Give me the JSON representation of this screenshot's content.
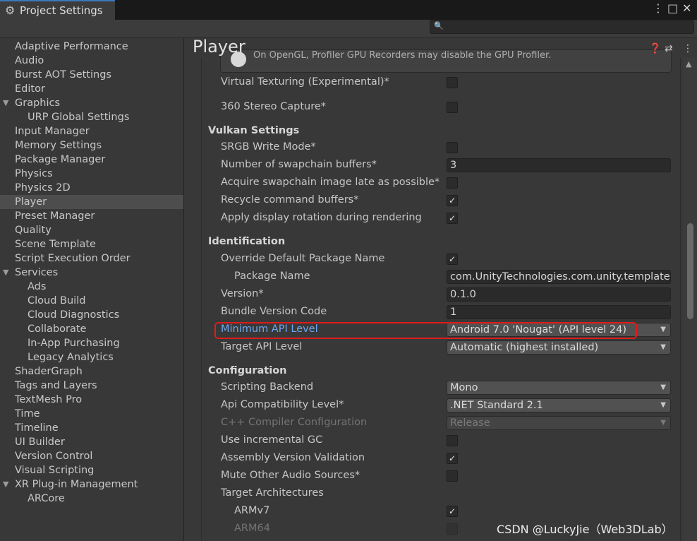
{
  "window": {
    "title": "Project Settings",
    "icons": {
      "tab": "gear-icon",
      "menu": "kebab-menu-icon",
      "maximize": "maximize-icon",
      "close": "close-icon"
    }
  },
  "search": {
    "placeholder": "",
    "icon": "search-icon"
  },
  "sidebar": {
    "items": [
      {
        "label": "Adaptive Performance",
        "indent": 0
      },
      {
        "label": "Audio",
        "indent": 0
      },
      {
        "label": "Burst AOT Settings",
        "indent": 0
      },
      {
        "label": "Editor",
        "indent": 0
      },
      {
        "label": "Graphics",
        "indent": 0,
        "expanded": true
      },
      {
        "label": "URP Global Settings",
        "indent": 1
      },
      {
        "label": "Input Manager",
        "indent": 0
      },
      {
        "label": "Memory Settings",
        "indent": 0
      },
      {
        "label": "Package Manager",
        "indent": 0
      },
      {
        "label": "Physics",
        "indent": 0
      },
      {
        "label": "Physics 2D",
        "indent": 0
      },
      {
        "label": "Player",
        "indent": 0,
        "selected": true
      },
      {
        "label": "Preset Manager",
        "indent": 0
      },
      {
        "label": "Quality",
        "indent": 0
      },
      {
        "label": "Scene Template",
        "indent": 0
      },
      {
        "label": "Script Execution Order",
        "indent": 0
      },
      {
        "label": "Services",
        "indent": 0,
        "expanded": true
      },
      {
        "label": "Ads",
        "indent": 1
      },
      {
        "label": "Cloud Build",
        "indent": 1
      },
      {
        "label": "Cloud Diagnostics",
        "indent": 1
      },
      {
        "label": "Collaborate",
        "indent": 1
      },
      {
        "label": "In-App Purchasing",
        "indent": 1
      },
      {
        "label": "Legacy Analytics",
        "indent": 1
      },
      {
        "label": "ShaderGraph",
        "indent": 0
      },
      {
        "label": "Tags and Layers",
        "indent": 0
      },
      {
        "label": "TextMesh Pro",
        "indent": 0
      },
      {
        "label": "Time",
        "indent": 0
      },
      {
        "label": "Timeline",
        "indent": 0
      },
      {
        "label": "UI Builder",
        "indent": 0
      },
      {
        "label": "Version Control",
        "indent": 0
      },
      {
        "label": "Visual Scripting",
        "indent": 0
      },
      {
        "label": "XR Plug-in Management",
        "indent": 0,
        "expanded": true
      },
      {
        "label": "ARCore",
        "indent": 1
      }
    ]
  },
  "main": {
    "title": "Player",
    "header_icons": [
      "help-icon",
      "presets-icon",
      "kebab-menu-icon"
    ],
    "help_box_text": "On OpenGL, Profiler GPU Recorders may disable the GPU Profiler.",
    "rows": [
      {
        "kind": "checkbox",
        "label": "Virtual Texturing (Experimental)*",
        "checked": false
      },
      {
        "kind": "checkbox",
        "label": "360 Stereo Capture*",
        "checked": false
      },
      {
        "kind": "section",
        "label": "Vulkan Settings"
      },
      {
        "kind": "checkbox",
        "label": "SRGB Write Mode*",
        "checked": false
      },
      {
        "kind": "field",
        "label": "Number of swapchain buffers*",
        "value": "3"
      },
      {
        "kind": "checkbox",
        "label": "Acquire swapchain image late as possible*",
        "checked": false
      },
      {
        "kind": "checkbox",
        "label": "Recycle command buffers*",
        "checked": true
      },
      {
        "kind": "checkbox",
        "label": "Apply display rotation during rendering",
        "checked": true
      },
      {
        "kind": "section",
        "label": "Identification"
      },
      {
        "kind": "checkbox",
        "label": "Override Default Package Name",
        "checked": true
      },
      {
        "kind": "field",
        "label": "Package Name",
        "value": "com.UnityTechnologies.com.unity.template.urpblank",
        "indent": 1
      },
      {
        "kind": "field",
        "label": "Version*",
        "value": "0.1.0"
      },
      {
        "kind": "field",
        "label": "Bundle Version Code",
        "value": "1"
      },
      {
        "kind": "dropdown",
        "label": "Minimum API Level",
        "value": "Android 7.0 'Nougat' (API level 24)",
        "selected": true,
        "highlighted": true
      },
      {
        "kind": "dropdown",
        "label": "Target API Level",
        "value": "Automatic (highest installed)"
      },
      {
        "kind": "section",
        "label": "Configuration"
      },
      {
        "kind": "dropdown",
        "label": "Scripting Backend",
        "value": "Mono"
      },
      {
        "kind": "dropdown",
        "label": "Api Compatibility Level*",
        "value": ".NET Standard 2.1"
      },
      {
        "kind": "dropdown",
        "label": "C++ Compiler Configuration",
        "value": "Release",
        "disabled": true
      },
      {
        "kind": "checkbox",
        "label": "Use incremental GC",
        "checked": false
      },
      {
        "kind": "checkbox",
        "label": "Assembly Version Validation",
        "checked": true
      },
      {
        "kind": "checkbox",
        "label": "Mute Other Audio Sources*",
        "checked": false
      },
      {
        "kind": "label",
        "label": "Target Architectures"
      },
      {
        "kind": "checkbox",
        "label": "ARMv7",
        "checked": true,
        "indent": 1
      },
      {
        "kind": "checkbox",
        "label": "ARM64",
        "checked": false,
        "indent": 1,
        "disabled": true
      }
    ]
  },
  "watermark": "CSDN @LuckyJie（Web3DLab）",
  "colors": {
    "accent": "#3a79bb",
    "selected_label": "#6fa8ee",
    "highlight_box": "#e01b1b",
    "background": "#383838"
  }
}
